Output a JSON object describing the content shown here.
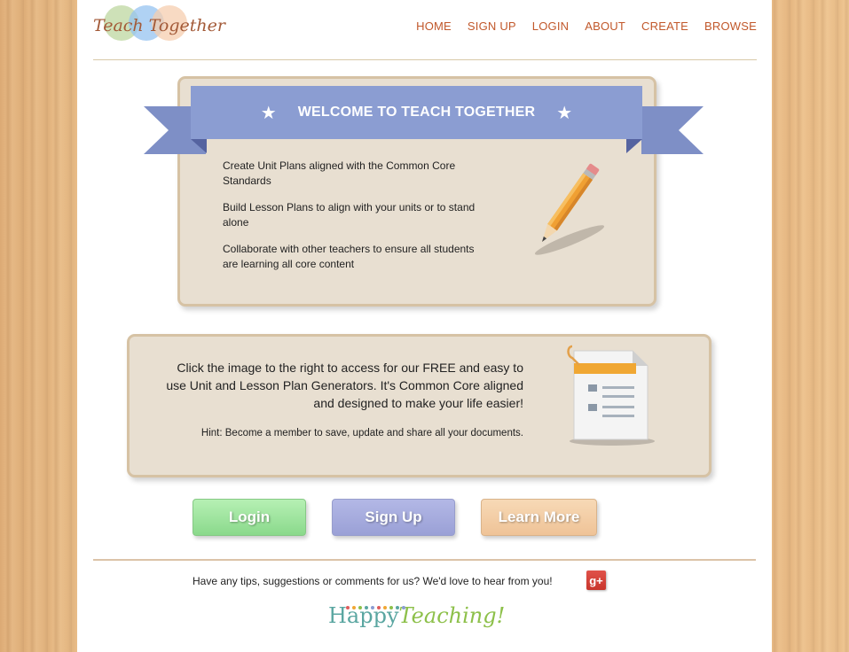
{
  "header": {
    "logo_text": "Teach Together",
    "nav": [
      "HOME",
      "SIGN UP",
      "LOGIN",
      "ABOUT",
      "CREATE",
      "BROWSE"
    ]
  },
  "welcome": {
    "title": "WELCOME TO TEACH TOGETHER",
    "star": "★",
    "items": [
      "Create Unit Plans aligned with the Common Core Standards",
      "Build Lesson Plans to align with your units or to stand alone",
      "Collaborate with other teachers to ensure all students are learning all core content"
    ]
  },
  "generator": {
    "text": "Click the image to the right to access for our FREE and easy to use Unit and Lesson Plan Generators. It's Common Core aligned and designed to make your life easier!",
    "hint": "Hint: Become a member to save, update and share all your documents."
  },
  "buttons": {
    "login": "Login",
    "signup": "Sign Up",
    "learn_more": "Learn More"
  },
  "footer": {
    "feedback": "Have any tips, suggestions or comments for us? We'd love to hear from you!",
    "gplus_label": "g+",
    "brand_part1": "Happy",
    "brand_part2": "Teaching!"
  },
  "colors": {
    "nav": "#c1582b",
    "ribbon": "#8b9dd2",
    "card": "#e8dfd1",
    "login": "#9ee39f",
    "signup": "#a5abdd",
    "learn": "#f2cba2"
  }
}
